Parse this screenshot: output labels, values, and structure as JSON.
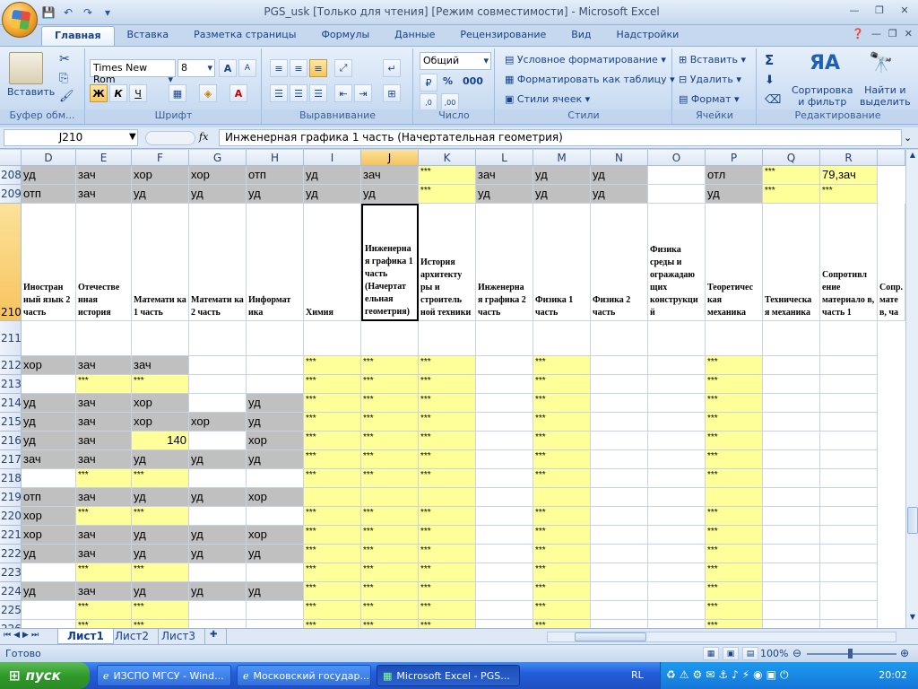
{
  "window": {
    "title": "PGS_usk  [Только для чтения]  [Режим совместимости] - Microsoft Excel"
  },
  "tabs": [
    "Главная",
    "Вставка",
    "Разметка страницы",
    "Формулы",
    "Данные",
    "Рецензирование",
    "Вид",
    "Надстройки"
  ],
  "ribbon": {
    "clipboard": {
      "paste": "Вставить",
      "label": "Буфер обм..."
    },
    "font": {
      "name": "Times New Rom",
      "size": "8",
      "label": "Шрифт",
      "bold": "Ж",
      "italic": "К",
      "underline": "Ч"
    },
    "alignment": {
      "label": "Выравнивание"
    },
    "number": {
      "format": "Общий",
      "percent": "%",
      "thousands": "000",
      "label": "Число"
    },
    "styles": {
      "conditional": "Условное форматирование",
      "as_table": "Форматировать как таблицу",
      "cell_styles": "Стили ячеек",
      "label": "Стили"
    },
    "cells": {
      "insert": "Вставить",
      "delete": "Удалить",
      "format": "Формат",
      "label": "Ячейки"
    },
    "editing": {
      "sum": "Σ",
      "sort": "Сортировка",
      "sort2": "и фильтр",
      "find": "Найти и",
      "find2": "выделить",
      "label": "Редактирование"
    }
  },
  "formula_bar": {
    "name_box": "J210",
    "fx": "fx",
    "content": "Инженерная графика 1 часть (Начертательная геометрия)"
  },
  "columns": [
    "D",
    "E",
    "F",
    "G",
    "H",
    "I",
    "J",
    "K",
    "L",
    "M",
    "N",
    "O",
    "P",
    "Q",
    "R"
  ],
  "row_208": [
    "уд",
    "зач",
    "хор",
    "хор",
    "отп",
    "уд",
    "зач",
    "***",
    "зач",
    "уд",
    "уд",
    "",
    "отл",
    "***",
    "79,зач"
  ],
  "row_209": [
    "отп",
    "зач",
    "уд",
    "уд",
    "уд",
    "уд",
    "уд",
    "***",
    "уд",
    "уд",
    "уд",
    "",
    "уд",
    "***",
    "***"
  ],
  "header_row": {
    "number": "210",
    "cells": [
      "Иностран ный язык 2 часть",
      "Отечестве нная история",
      "Математи ка 1 часть",
      "Математи ка 2 часть",
      "Информат ика",
      "Химия",
      "Инженерна я графика 1 часть (Начертат ельная геометрия)",
      "История архитекту ры и строитель ной техники",
      "Инженерна я графика 2 часть",
      "Физика 1 часть",
      "Физика 2 часть",
      "Физика среды и огражадаю щих конструкци й",
      "Теоретичес кая механика",
      "Техническа я механика",
      "Сопротивл ение материало в, часть 1",
      "Сопр. мате в, ча"
    ]
  },
  "rows": [
    {
      "n": "211",
      "v": [
        "",
        "",
        "",
        "",
        "",
        "",
        "",
        "",
        "",
        "",
        "",
        "",
        "",
        "",
        ""
      ]
    },
    {
      "n": "212",
      "v": [
        "хор",
        "зач",
        "зач",
        "",
        "",
        "***",
        "***",
        "***",
        "",
        "***",
        "",
        "",
        "***",
        "",
        ""
      ]
    },
    {
      "n": "213",
      "v": [
        "",
        "***",
        "***",
        "",
        "",
        "***",
        "***",
        "***",
        "",
        "***",
        "",
        "",
        "***",
        "",
        ""
      ]
    },
    {
      "n": "214",
      "v": [
        "уд",
        "зач",
        "хор",
        "",
        "уд",
        "***",
        "***",
        "***",
        "",
        "***",
        "",
        "",
        "***",
        "",
        ""
      ]
    },
    {
      "n": "215",
      "v": [
        "уд",
        "зач",
        "хор",
        "хор",
        "уд",
        "***",
        "***",
        "***",
        "",
        "***",
        "",
        "",
        "***",
        "",
        ""
      ]
    },
    {
      "n": "216",
      "v": [
        "уд",
        "зач",
        "140",
        "",
        "хор",
        "***",
        "***",
        "***",
        "",
        "***",
        "",
        "",
        "***",
        "",
        ""
      ]
    },
    {
      "n": "217",
      "v": [
        "зач",
        "зач",
        "уд",
        "уд",
        "уд",
        "***",
        "***",
        "***",
        "",
        "***",
        "",
        "",
        "***",
        "",
        ""
      ]
    },
    {
      "n": "218",
      "v": [
        "",
        "***",
        "***",
        "",
        "",
        "***",
        "***",
        "***",
        "",
        "***",
        "",
        "",
        "***",
        "",
        ""
      ]
    },
    {
      "n": "219",
      "v": [
        "отп",
        "зач",
        "уд",
        "уд",
        "хор",
        "",
        "",
        "",
        "",
        "",
        "",
        "",
        "",
        "",
        ""
      ]
    },
    {
      "n": "220",
      "v": [
        "хор",
        "***",
        "***",
        "",
        "",
        "***",
        "***",
        "***",
        "",
        "***",
        "",
        "",
        "***",
        "",
        ""
      ]
    },
    {
      "n": "221",
      "v": [
        "хор",
        "зач",
        "уд",
        "уд",
        "хор",
        "***",
        "***",
        "***",
        "",
        "***",
        "",
        "",
        "***",
        "",
        ""
      ]
    },
    {
      "n": "222",
      "v": [
        "уд",
        "зач",
        "уд",
        "уд",
        "уд",
        "***",
        "***",
        "***",
        "",
        "***",
        "",
        "",
        "***",
        "",
        ""
      ]
    },
    {
      "n": "223",
      "v": [
        "",
        "***",
        "***",
        "",
        "",
        "***",
        "***",
        "***",
        "",
        "***",
        "",
        "",
        "***",
        "",
        ""
      ]
    },
    {
      "n": "224",
      "v": [
        "уд",
        "зач",
        "уд",
        "уд",
        "уд",
        "***",
        "***",
        "***",
        "",
        "***",
        "",
        "",
        "***",
        "",
        ""
      ]
    },
    {
      "n": "225",
      "v": [
        "",
        "***",
        "***",
        "",
        "",
        "***",
        "***",
        "***",
        "",
        "***",
        "",
        "",
        "***",
        "",
        ""
      ]
    },
    {
      "n": "226",
      "v": [
        "",
        "***",
        "***",
        "",
        "",
        "***",
        "***",
        "***",
        "",
        "***",
        "",
        "",
        "***",
        "",
        ""
      ]
    }
  ],
  "sheets": [
    "Лист1",
    "Лист2",
    "Лист3"
  ],
  "status": {
    "ready": "Готово",
    "zoom": "100%"
  },
  "taskbar": {
    "start": "пуск",
    "items": [
      "ИЗСПО МГСУ - Wind...",
      "Московский государ...",
      "Microsoft Excel - PGS..."
    ],
    "lang": "RL",
    "clock": "20:02"
  }
}
